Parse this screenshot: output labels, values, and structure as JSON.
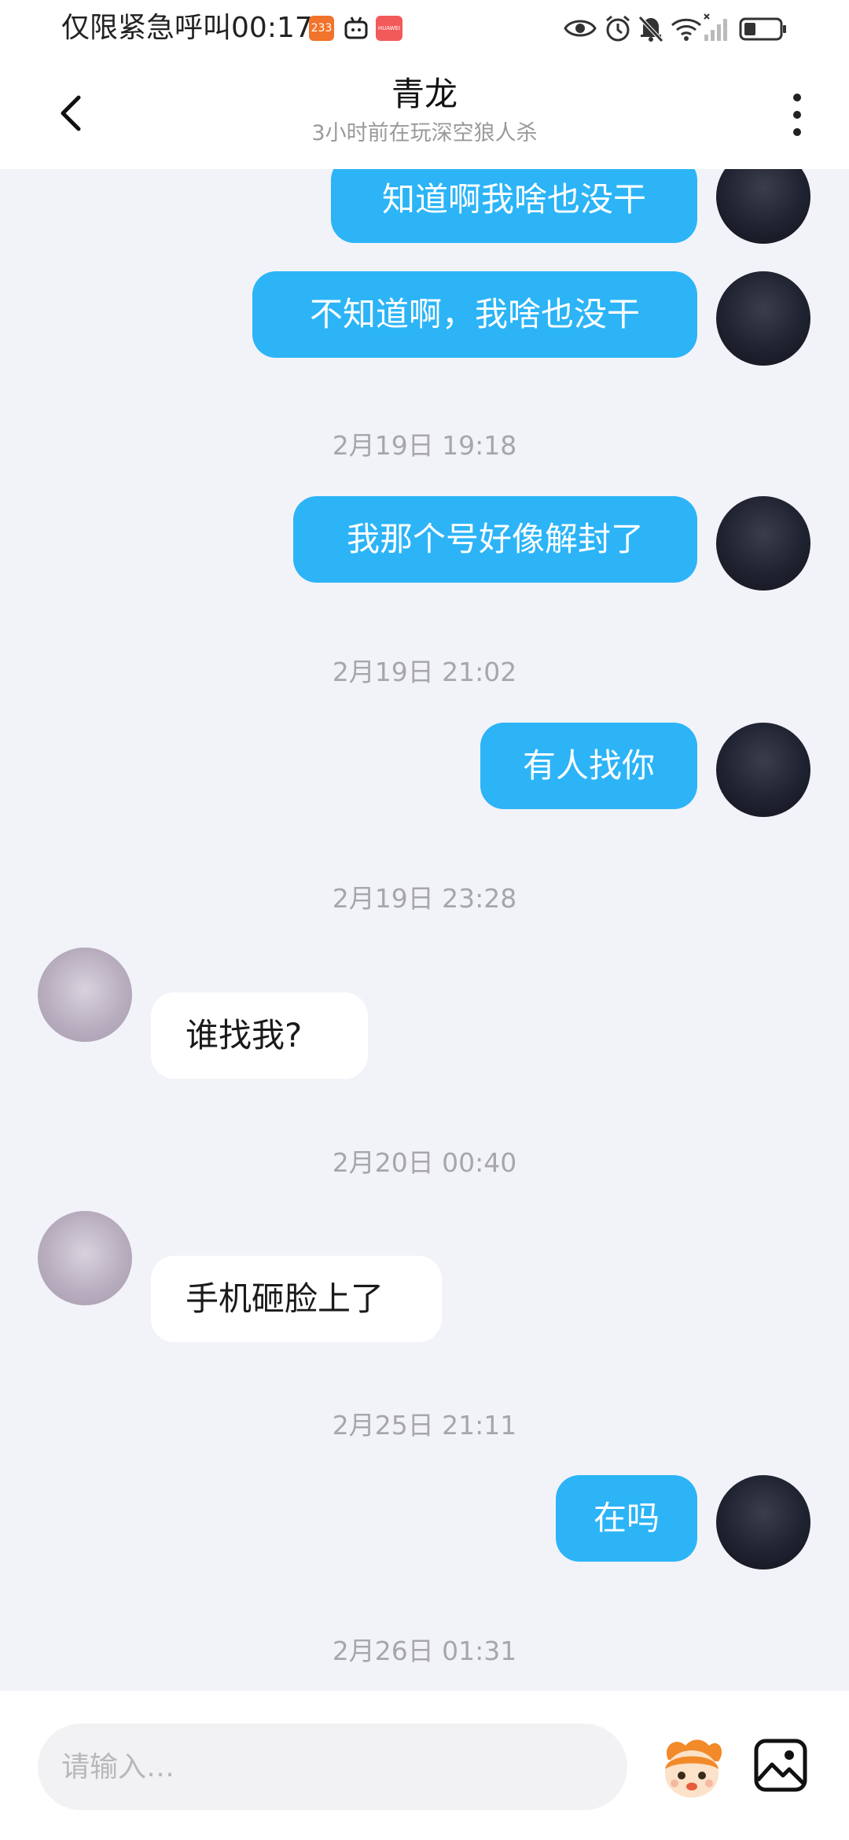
{
  "status_bar": {
    "carrier_text": "仅限紧急呼叫",
    "time": "00:17",
    "app_badge_1": "233",
    "app_badge_2": "HUAWEI"
  },
  "header": {
    "title": "青龙",
    "subtitle": "3小时前在玩深空狼人杀"
  },
  "messages": [
    {
      "type": "out",
      "text": "知道啊我啥也没干"
    },
    {
      "type": "out",
      "text": "不知道啊，我啥也没干"
    },
    {
      "type": "time",
      "text": "2月19日 19:18"
    },
    {
      "type": "out",
      "text": "我那个号好像解封了"
    },
    {
      "type": "time",
      "text": "2月19日 21:02"
    },
    {
      "type": "out",
      "text": "有人找你"
    },
    {
      "type": "time",
      "text": "2月19日 23:28"
    },
    {
      "type": "in",
      "text": "谁找我?"
    },
    {
      "type": "time",
      "text": "2月20日 00:40"
    },
    {
      "type": "in",
      "text": "手机砸脸上了"
    },
    {
      "type": "time",
      "text": "2月25日 21:11"
    },
    {
      "type": "out",
      "text": "在吗"
    },
    {
      "type": "time",
      "text": "2月26日 01:31"
    }
  ],
  "input": {
    "placeholder": "请输入…"
  },
  "icons": {
    "back": "chevron-left-icon",
    "more": "more-vertical-icon",
    "emoji": "emoji-mascot-icon",
    "image": "image-icon"
  },
  "colors": {
    "outgoing_bubble": "#2cb4f7",
    "incoming_bubble": "#ffffff",
    "background": "#f2f3f8"
  }
}
